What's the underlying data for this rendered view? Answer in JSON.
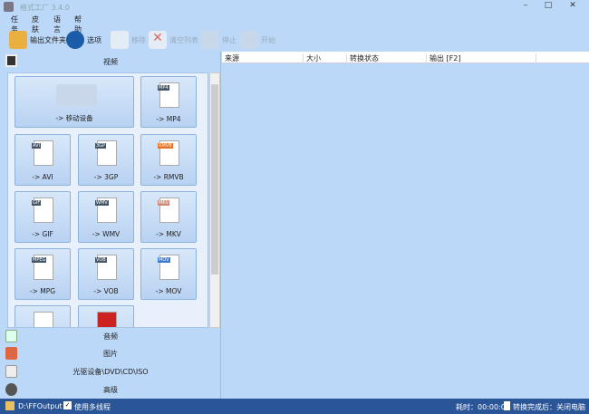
{
  "app": {
    "title": "格式工厂 3.4.0"
  },
  "menu": [
    "任务",
    "皮肤",
    "语言",
    "帮助"
  ],
  "toolbar": {
    "output_folder": "输出文件夹",
    "options": "选项",
    "remove": "移除",
    "clear_list": "清空列表",
    "stop": "停止",
    "start": "开始"
  },
  "left": {
    "video_header": "视频",
    "tiles": [
      {
        "label": "-> 移动设备",
        "badge": ""
      },
      {
        "label": "-> MP4",
        "badge": "MP4"
      },
      {
        "label": "-> AVI",
        "badge": "AVI"
      },
      {
        "label": "-> 3GP",
        "badge": "3GP"
      },
      {
        "label": "-> RMVB",
        "badge": "RMVB"
      },
      {
        "label": "-> GIF",
        "badge": "GIF"
      },
      {
        "label": "-> WMV",
        "badge": "WMV"
      },
      {
        "label": "-> MKV",
        "badge": "MKV"
      },
      {
        "label": "-> MPG",
        "badge": "MPEG"
      },
      {
        "label": "-> VOB",
        "badge": "VOB"
      },
      {
        "label": "-> MOV",
        "badge": "MOV"
      }
    ],
    "categories": [
      "音频",
      "图片",
      "光驱设备\\DVD\\CD\\ISO",
      "高级"
    ]
  },
  "table": {
    "columns": [
      "来源",
      "大小",
      "转换状态",
      "输出 [F2]"
    ]
  },
  "status": {
    "path": "D:\\FFOutput",
    "multithread": "使用多线程",
    "elapsed": "耗时：00:00:00",
    "after": "转换完成后：关闭电脑"
  }
}
